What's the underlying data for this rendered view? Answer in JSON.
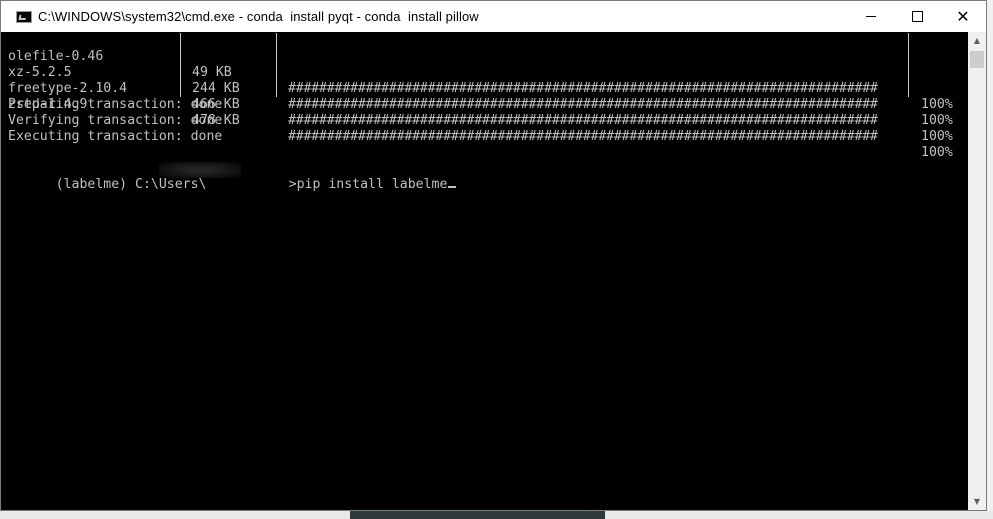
{
  "window": {
    "title": "C:\\WINDOWS\\system32\\cmd.exe - conda  install pyqt - conda  install pillow",
    "controls": {
      "minimize_icon": "minimize-icon",
      "maximize_icon": "maximize-icon",
      "close_icon": "close-icon"
    }
  },
  "console": {
    "packages": [
      {
        "name": "olefile-0.46",
        "size": "49 KB",
        "bar": "############################################################################",
        "percent": "100%"
      },
      {
        "name": "xz-5.2.5",
        "size": "244 KB",
        "bar": "############################################################################",
        "percent": "100%"
      },
      {
        "name": "freetype-2.10.4",
        "size": "466 KB",
        "bar": "############################################################################",
        "percent": "100%"
      },
      {
        "name": "zstd-1.4.9",
        "size": "478 KB",
        "bar": "############################################################################",
        "percent": "100%"
      }
    ],
    "status_lines": [
      "Preparing transaction: done",
      "Verifying transaction: done",
      "Executing transaction: done"
    ],
    "prompt": {
      "prefix": "(labelme) C:\\Users\\",
      "suffix": ">pip install labelme"
    }
  },
  "colors": {
    "console_bg": "#000000",
    "console_text": "#c0c0c0",
    "titlebar_bg": "#ffffff"
  }
}
